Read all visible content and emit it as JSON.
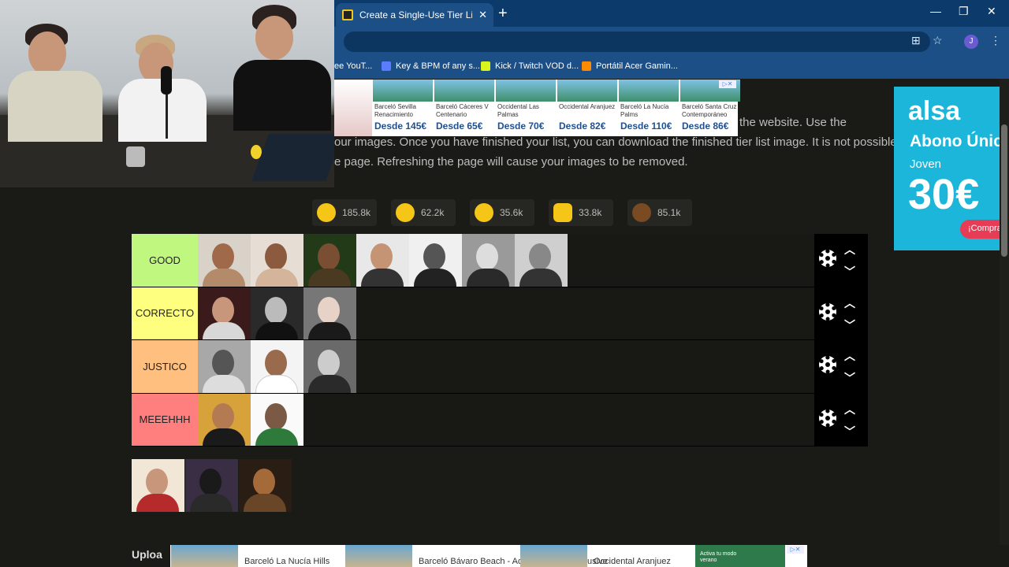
{
  "browser": {
    "tab_title": "Create a Single-Use Tier List (Pr",
    "tab_close": "✕",
    "new_tab": "+",
    "window_controls": [
      "—",
      "❐",
      "✕"
    ],
    "avatar_letter": "J",
    "bookmarks": [
      {
        "label": "ee YouT...",
        "icon_color": "#ff0000"
      },
      {
        "label": "Key & BPM of any s...",
        "icon_color": "#5b7cff"
      },
      {
        "label": "Kick / Twitch VOD d...",
        "icon_color": "#d8f51d"
      },
      {
        "label": "Portátil Acer Gamin...",
        "icon_color": "#ff8a00"
      }
    ]
  },
  "page": {
    "text_line1": "the website. Use the",
    "text_line2": "our images. Once you have finished your list, you can download the finished tier list image. It is not possible",
    "text_line3": "e page. Refreshing the page will cause your images to be removed.",
    "upload_label": "Uploa"
  },
  "reactions": [
    {
      "emoji": "grinning-face",
      "count": "185.8k"
    },
    {
      "emoji": "heart-eyes-face",
      "count": "62.2k"
    },
    {
      "emoji": "tears-of-joy-face",
      "count": "35.6k"
    },
    {
      "emoji": "raised-hands",
      "count": "33.8k"
    },
    {
      "emoji": "pile-of-poo",
      "count": "85.1k"
    }
  ],
  "tiers": [
    {
      "label": "GOOD",
      "color": "#bff77f",
      "item_count": 7
    },
    {
      "label": "CORRECTO",
      "color": "#ffff7f",
      "item_count": 3
    },
    {
      "label": "JUSTICO",
      "color": "#ffbf7f",
      "item_count": 3
    },
    {
      "label": "MEEEHHH",
      "color": "#ff7f7f",
      "item_count": 2
    }
  ],
  "pool_item_count": 3,
  "ads": {
    "top_hotels": [
      {
        "name": "Barceló Sevilla Renacimiento",
        "price": "Desde 145€"
      },
      {
        "name": "Barceló Cáceres V Centenario",
        "price": "Desde 65€"
      },
      {
        "name": "Occidental Las Palmas",
        "price": "Desde 70€"
      },
      {
        "name": "Occidental Aranjuez",
        "price": "Desde 82€"
      },
      {
        "name": "Barceló La Nucía Palms",
        "price": "Desde 110€"
      },
      {
        "name": "Barceló Santa Cruz Contemporáneo",
        "price": "Desde 86€"
      }
    ],
    "right": {
      "brand": "alsa",
      "line1": "Abono Únic",
      "line2": "Joven",
      "line3": "30€",
      "cta": "¡Compra"
    },
    "bottom": [
      {
        "text": "Barceló La Nucía Hills"
      },
      {
        "text": "Barceló Bávaro Beach - Adults only - All Inclusive"
      },
      {
        "text": "Occidental Aranjuez"
      },
      {
        "text": "Activa tu modo verano"
      }
    ]
  }
}
